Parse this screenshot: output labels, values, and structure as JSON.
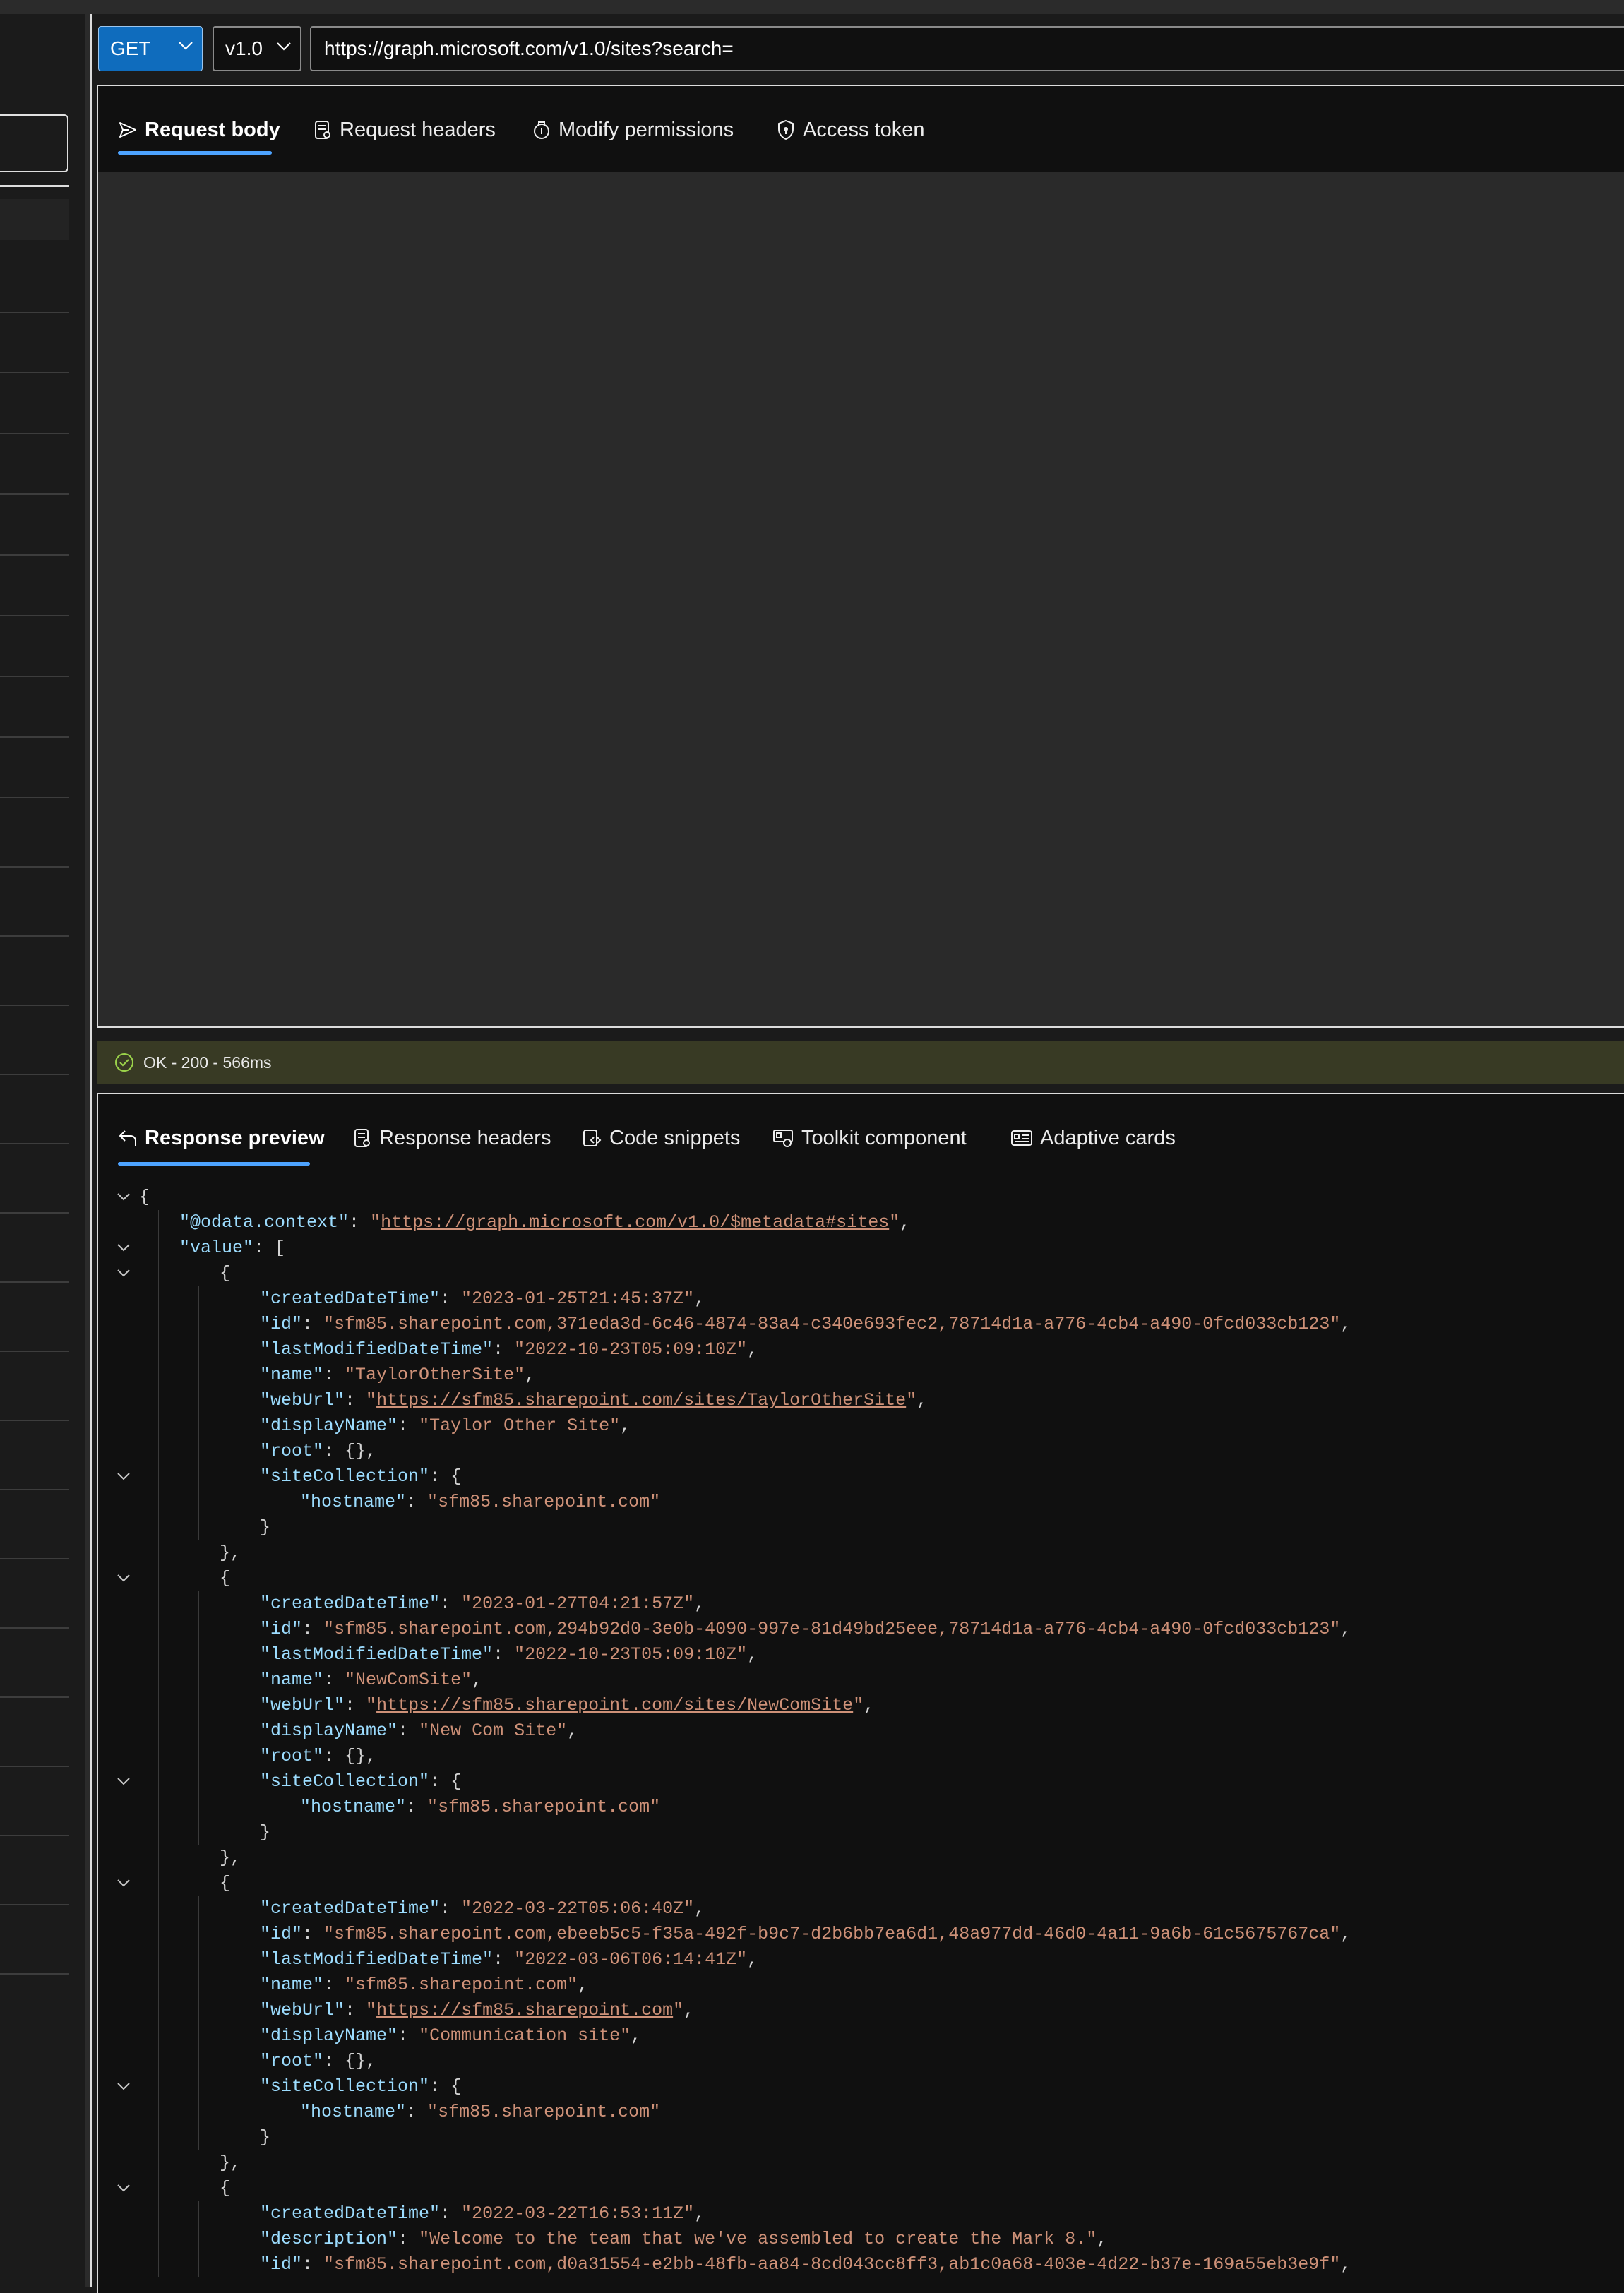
{
  "request": {
    "method": "GET",
    "version": "v1.0",
    "url": "https://graph.microsoft.com/v1.0/sites?search="
  },
  "request_tabs": [
    "Request body",
    "Request headers",
    "Modify permissions",
    "Access token"
  ],
  "status": "OK - 200 - 566ms",
  "response_tabs": [
    "Response preview",
    "Response headers",
    "Code snippets",
    "Toolkit component",
    "Adaptive cards"
  ],
  "json_lines": [
    {
      "t": "{"
    },
    {
      "k": "@odata.context",
      "v": "https://graph.microsoft.com/v1.0/$metadata#sites"
    },
    {
      "k": "value",
      "t": "["
    },
    {
      "t": "{"
    },
    {
      "k": "createdDateTime",
      "v": "2023-01-25T21:45:37Z"
    },
    {
      "k": "id",
      "v": "sfm85.sharepoint.com,371eda3d-6c46-4874-83a4-c340e693fec2,78714d1a-a776-4cb4-a490-0fcd033cb123"
    },
    {
      "k": "lastModifiedDateTime",
      "v": "2022-10-23T05:09:10Z"
    },
    {
      "k": "name",
      "v": "TaylorOtherSite"
    },
    {
      "k": "webUrl",
      "v": "https://sfm85.sharepoint.com/sites/TaylorOtherSite"
    },
    {
      "k": "displayName",
      "v": "Taylor Other Site"
    },
    {
      "k": "root",
      "t": "{},"
    },
    {
      "k": "siteCollection",
      "t": "{"
    },
    {
      "k": "hostname",
      "v": "sfm85.sharepoint.com"
    },
    {
      "t": "}"
    },
    {
      "t": "},"
    },
    {
      "t": "{"
    },
    {
      "k": "createdDateTime",
      "v": "2023-01-27T04:21:57Z"
    },
    {
      "k": "id",
      "v": "sfm85.sharepoint.com,294b92d0-3e0b-4090-997e-81d49bd25eee,78714d1a-a776-4cb4-a490-0fcd033cb123"
    },
    {
      "k": "lastModifiedDateTime",
      "v": "2022-10-23T05:09:10Z"
    },
    {
      "k": "name",
      "v": "NewComSite"
    },
    {
      "k": "webUrl",
      "v": "https://sfm85.sharepoint.com/sites/NewComSite"
    },
    {
      "k": "displayName",
      "v": "New Com Site"
    },
    {
      "k": "root",
      "t": "{},"
    },
    {
      "k": "siteCollection",
      "t": "{"
    },
    {
      "k": "hostname",
      "v": "sfm85.sharepoint.com"
    },
    {
      "t": "}"
    },
    {
      "t": "},"
    },
    {
      "t": "{"
    },
    {
      "k": "createdDateTime",
      "v": "2022-03-22T05:06:40Z"
    },
    {
      "k": "id",
      "v": "sfm85.sharepoint.com,ebeeb5c5-f35a-492f-b9c7-d2b6bb7ea6d1,48a977dd-46d0-4a11-9a6b-61c5675767ca"
    },
    {
      "k": "lastModifiedDateTime",
      "v": "2022-03-06T06:14:41Z"
    },
    {
      "k": "name",
      "v": "sfm85.sharepoint.com"
    },
    {
      "k": "webUrl",
      "v": "https://sfm85.sharepoint.com"
    },
    {
      "k": "displayName",
      "v": "Communication site"
    },
    {
      "k": "root",
      "t": "{},"
    },
    {
      "k": "siteCollection",
      "t": "{"
    },
    {
      "k": "hostname",
      "v": "sfm85.sharepoint.com"
    },
    {
      "t": "}"
    },
    {
      "t": "},"
    },
    {
      "t": "{"
    },
    {
      "k": "createdDateTime",
      "v": "2022-03-22T16:53:11Z"
    },
    {
      "k": "description",
      "v": "Welcome to the team that we've assembled to create the Mark 8."
    },
    {
      "k": "id",
      "v": "sfm85.sharepoint.com,d0a31554-e2bb-48fb-aa84-8cd043cc8ff3,ab1c0a68-403e-4d22-b37e-169a55eb3e9f"
    }
  ]
}
